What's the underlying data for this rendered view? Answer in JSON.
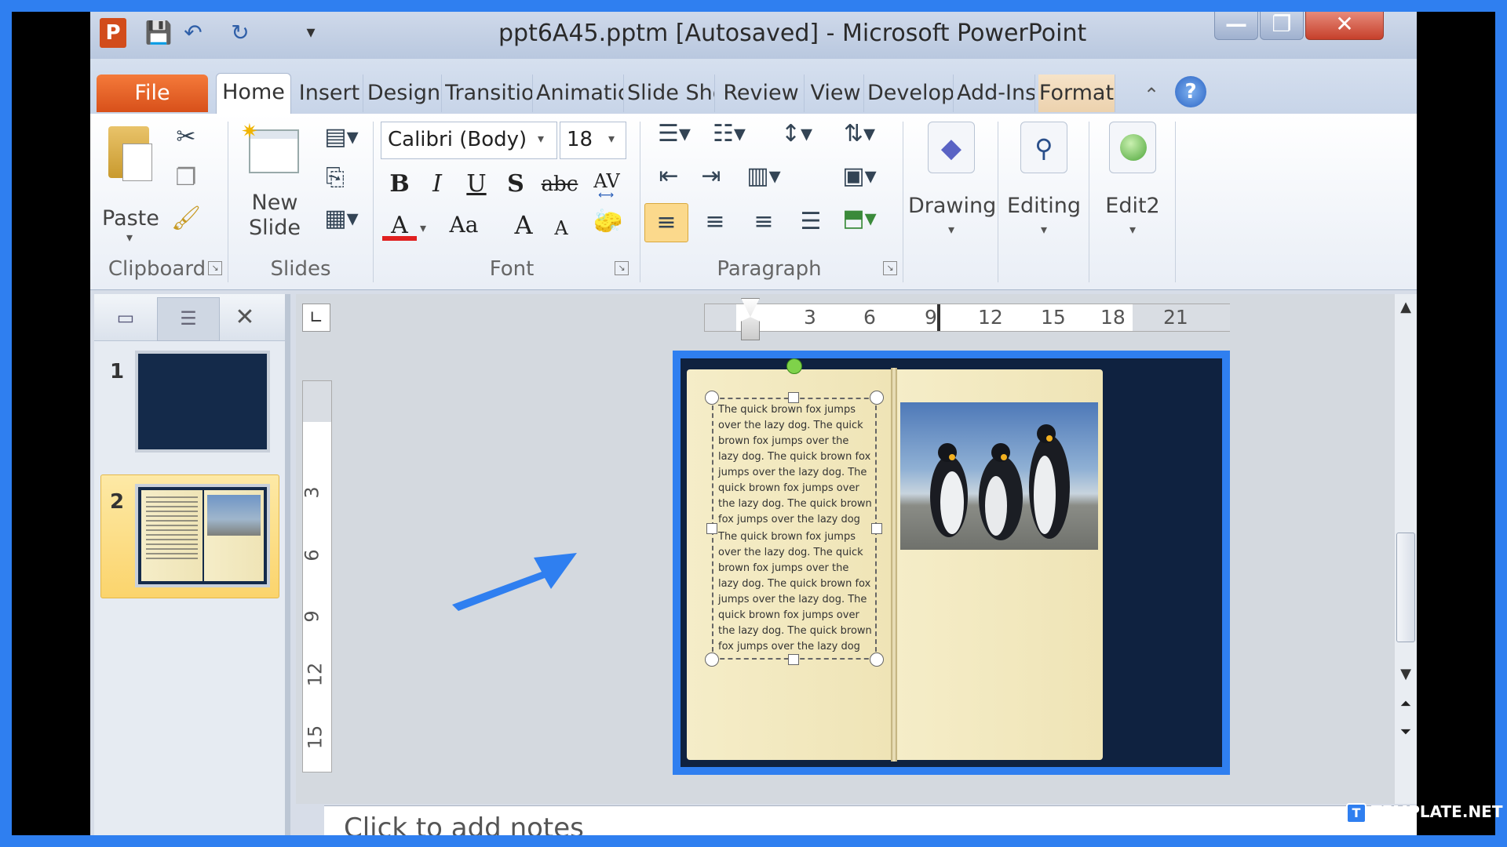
{
  "window": {
    "title": "ppt6A45.pptm [Autosaved]  -  Microsoft PowerPoint",
    "minimize_glyph": "—",
    "restore_glyph": "❐",
    "close_glyph": "✕"
  },
  "quick_access": {
    "app_icon": "P",
    "save_icon": "💾",
    "undo_icon": "↶",
    "redo_icon": "↻",
    "customize_icon": "▾"
  },
  "tabs": [
    {
      "label": "File"
    },
    {
      "label": "Home"
    },
    {
      "label": "Insert"
    },
    {
      "label": "Design"
    },
    {
      "label": "Transitio"
    },
    {
      "label": "Animatic"
    },
    {
      "label": "Slide Shö"
    },
    {
      "label": "Review"
    },
    {
      "label": "View"
    },
    {
      "label": "Develop"
    },
    {
      "label": "Add-Ins"
    },
    {
      "label": "Format"
    }
  ],
  "ribbon": {
    "clipboard": {
      "paste_label": "Paste",
      "group_label": "Clipboard"
    },
    "slides": {
      "new_slide_label_1": "New",
      "new_slide_label_2": "Slide",
      "group_label": "Slides"
    },
    "font": {
      "font_name": "Calibri (Body)",
      "font_size": "18",
      "bold": "B",
      "italic": "I",
      "underline": "U",
      "shadow": "S",
      "strike": "abc",
      "spacing": "AV",
      "color": "A",
      "change_case": "Aa",
      "grow": "A",
      "shrink": "A",
      "group_label": "Font"
    },
    "paragraph": {
      "group_label": "Paragraph"
    },
    "drawing": {
      "label": "Drawing"
    },
    "editing": {
      "label": "Editing"
    },
    "edit2": {
      "label": "Edit2"
    }
  },
  "slide_pane": {
    "slides": [
      {
        "number": "1"
      },
      {
        "number": "2"
      }
    ]
  },
  "rulers": {
    "horizontal": [
      "3",
      "6",
      "9",
      "12",
      "15",
      "18",
      "21"
    ],
    "vertical": [
      "3",
      "6",
      "9",
      "12",
      "15"
    ]
  },
  "slide": {
    "paragraph_1": "The quick brown fox jumps over the lazy dog. The quick brown fox jumps over the lazy dog. The quick brown fox jumps over the lazy dog. The quick brown fox jumps over the lazy dog. The quick brown fox jumps over the lazy dog",
    "paragraph_2": "The quick brown fox jumps over the lazy dog. The quick brown fox jumps over the lazy dog. The quick brown fox jumps over the lazy dog. The quick brown fox jumps over the lazy dog. The quick brown fox jumps over the lazy dog"
  },
  "notes": {
    "placeholder": "Click to add notes"
  },
  "watermark": {
    "text": "TEMPLATE.NET"
  },
  "colors": {
    "highlight": "#2f7ff0",
    "file_tab": "#e0561f",
    "slide_bg": "#0f2240"
  }
}
